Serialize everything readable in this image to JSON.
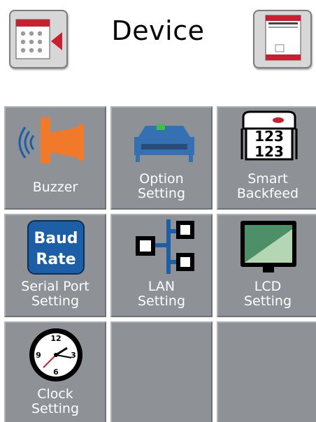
{
  "header": {
    "title": "Device",
    "back_icon": "device-back-icon",
    "home_icon": "printer-home-icon"
  },
  "tiles": [
    {
      "label": "Buzzer",
      "icon": "speaker-icon"
    },
    {
      "label": "Option\nSetting",
      "icon": "printer-option-icon"
    },
    {
      "label": "Smart\nBackfeed",
      "icon": "label-backfeed-icon"
    },
    {
      "label": "Serial Port\nSetting",
      "icon": "baud-rate-icon",
      "icon_text_1": "Baud",
      "icon_text_2": "Rate"
    },
    {
      "label": "LAN\nSetting",
      "icon": "network-icon"
    },
    {
      "label": "LCD\nSetting",
      "icon": "monitor-icon"
    },
    {
      "label": "Clock\nSetting",
      "icon": "clock-icon"
    },
    {
      "label": ""
    },
    {
      "label": ""
    }
  ],
  "colors": {
    "tile": "#8e9196",
    "accent_red": "#c8202f",
    "icon_blue": "#1d5fa6",
    "orange": "#f07a2a"
  }
}
